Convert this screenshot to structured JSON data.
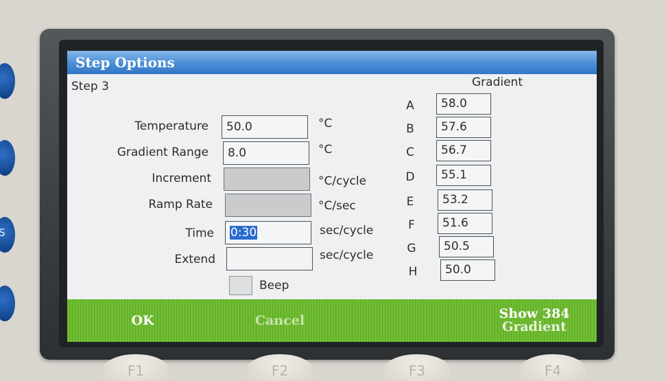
{
  "window": {
    "title": "Step Options",
    "step_label": "Step 3",
    "gradient_header": "Gradient"
  },
  "fields": [
    {
      "label": "Temperature",
      "value": "50.0",
      "unit": "°C"
    },
    {
      "label": "Gradient Range",
      "value": "8.0",
      "unit": "°C"
    },
    {
      "label": "Increment",
      "value": "",
      "unit": "°C/cycle"
    },
    {
      "label": "Ramp Rate",
      "value": "",
      "unit": "°C/sec"
    },
    {
      "label": "Time",
      "value": "0:30",
      "unit": "sec/cycle"
    },
    {
      "label": "Extend",
      "value": "",
      "unit": "sec/cycle"
    }
  ],
  "beep": {
    "label": "Beep",
    "checked": false
  },
  "gradient": [
    {
      "letter": "A",
      "value": "58.0"
    },
    {
      "letter": "B",
      "value": "57.6"
    },
    {
      "letter": "C",
      "value": "56.7"
    },
    {
      "letter": "D",
      "value": "55.1"
    },
    {
      "letter": "E",
      "value": "53.2"
    },
    {
      "letter": "F",
      "value": "51.6"
    },
    {
      "letter": "G",
      "value": "50.5"
    },
    {
      "letter": "H",
      "value": "50.0"
    }
  ],
  "softkeys": {
    "ok": "OK",
    "cancel": "Cancel",
    "show_gradient_line1": "Show 384",
    "show_gradient_line2": "Gradient"
  },
  "hardware": {
    "f1": "F1",
    "f2": "F2",
    "f3": "F3",
    "f4": "F4",
    "side_letter": "S"
  },
  "colors": {
    "titlebar": "#4a8ed6",
    "softbar": "#67b52a",
    "selection": "#2a6bd0",
    "side_buttons": "#154a92"
  }
}
